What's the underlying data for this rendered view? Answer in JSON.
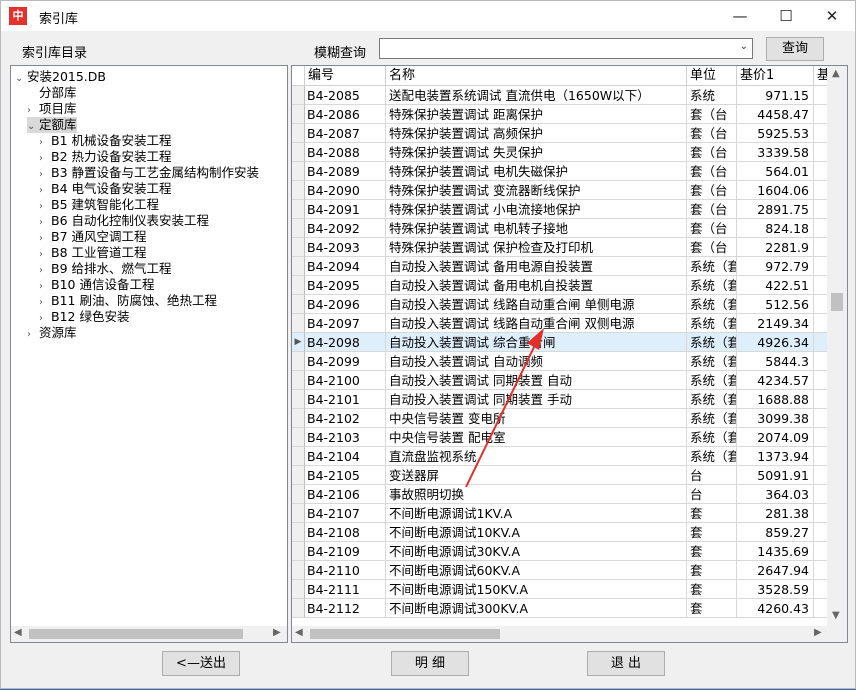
{
  "window": {
    "title": "索引库",
    "icon_text": "中"
  },
  "header": {
    "catalog_label": "索引库目录",
    "search_label": "模糊查询",
    "search_value": "",
    "search_button": "查询"
  },
  "tree": {
    "root": "安装2015.DB",
    "items": [
      {
        "label": "分部库",
        "level": 1,
        "expander": ""
      },
      {
        "label": "项目库",
        "level": 1,
        "expander": "›"
      },
      {
        "label": "定额库",
        "level": 1,
        "expander": "⌄",
        "selected": true
      },
      {
        "label": "B1 机械设备安装工程",
        "level": 2,
        "expander": "›"
      },
      {
        "label": "B2 热力设备安装工程",
        "level": 2,
        "expander": "›"
      },
      {
        "label": "B3 静置设备与工艺金属结构制作安装",
        "level": 2,
        "expander": "›"
      },
      {
        "label": "B4 电气设备安装工程",
        "level": 2,
        "expander": "›"
      },
      {
        "label": "B5 建筑智能化工程",
        "level": 2,
        "expander": "›"
      },
      {
        "label": "B6 自动化控制仪表安装工程",
        "level": 2,
        "expander": "›"
      },
      {
        "label": "B7 通风空调工程",
        "level": 2,
        "expander": "›"
      },
      {
        "label": "B8 工业管道工程",
        "level": 2,
        "expander": "›"
      },
      {
        "label": "B9 给排水、燃气工程",
        "level": 2,
        "expander": "›"
      },
      {
        "label": "B10 通信设备工程",
        "level": 2,
        "expander": "›"
      },
      {
        "label": "B11 刷油、防腐蚀、绝热工程",
        "level": 2,
        "expander": "›"
      },
      {
        "label": "B12 绿色安装",
        "level": 2,
        "expander": "›"
      },
      {
        "label": "资源库",
        "level": 1,
        "expander": "›"
      }
    ]
  },
  "table": {
    "columns": [
      "编号",
      "名称",
      "单位",
      "基价1",
      "基"
    ],
    "selected_marker": "▶",
    "rows": [
      [
        "B4-2085",
        "送配电装置系统调试 直流供电（1650W以下）",
        "系统",
        "971.15"
      ],
      [
        "B4-2086",
        "特殊保护装置调试    距离保护",
        "套（台",
        "4458.47"
      ],
      [
        "B4-2087",
        "特殊保护装置调试    高频保护",
        "套（台",
        "5925.53"
      ],
      [
        "B4-2088",
        "特殊保护装置调试    失灵保护",
        "套（台",
        "3339.58"
      ],
      [
        "B4-2089",
        "特殊保护装置调试    电机失磁保护",
        "套（台",
        "564.01"
      ],
      [
        "B4-2090",
        "特殊保护装置调试    变流器断线保护",
        "套（台",
        "1604.06"
      ],
      [
        "B4-2091",
        "特殊保护装置调试    小电流接地保护",
        "套（台",
        "2891.75"
      ],
      [
        "B4-2092",
        "特殊保护装置调试    电机转子接地",
        "套（台",
        "824.18"
      ],
      [
        "B4-2093",
        "特殊保护装置调试    保护检查及打印机",
        "套（台",
        "2281.9"
      ],
      [
        "B4-2094",
        "自动投入装置调试  备用电源自投装置",
        "系统（套",
        "972.79"
      ],
      [
        "B4-2095",
        "自动投入装置调试  备用电机自投装置",
        "系统（套",
        "422.51"
      ],
      [
        "B4-2096",
        "自动投入装置调试  线路自动重合闸  单侧电源",
        "系统（套",
        "512.56"
      ],
      [
        "B4-2097",
        "自动投入装置调试  线路自动重合闸  双侧电源",
        "系统（套",
        "2149.34"
      ],
      [
        "B4-2098",
        "自动投入装置调试  综合重合闸",
        "系统（套",
        "4926.34"
      ],
      [
        "B4-2099",
        "自动投入装置调试  自动调频",
        "系统（套",
        "5844.3"
      ],
      [
        "B4-2100",
        "自动投入装置调试  同期装置  自动",
        "系统（套",
        "4234.57"
      ],
      [
        "B4-2101",
        "自动投入装置调试  同期装置  手动",
        "系统（套",
        "1688.88"
      ],
      [
        "B4-2102",
        "中央信号装置  变电所",
        "系统（套",
        "3099.38"
      ],
      [
        "B4-2103",
        "中央信号装置  配电室",
        "系统（套",
        "2074.09"
      ],
      [
        "B4-2104",
        "直流盘监视系统",
        "系统（套",
        "1373.94"
      ],
      [
        "B4-2105",
        "变送器屏",
        "台",
        "5091.91"
      ],
      [
        "B4-2106",
        "事故照明切换",
        "台",
        "364.03"
      ],
      [
        "B4-2107",
        "不间断电源调试1KV.A",
        "套",
        "281.38"
      ],
      [
        "B4-2108",
        "不间断电源调试10KV.A",
        "套",
        "859.27"
      ],
      [
        "B4-2109",
        "不间断电源调试30KV.A",
        "套",
        "1435.69"
      ],
      [
        "B4-2110",
        "不间断电源调试60KV.A",
        "套",
        "2647.94"
      ],
      [
        "B4-2111",
        "不间断电源调试150KV.A",
        "套",
        "3528.59"
      ],
      [
        "B4-2112",
        "不间断电源调试300KV.A",
        "套",
        "4260.43"
      ]
    ],
    "selected_row_index": 13
  },
  "footer": {
    "back_button": "<—送出",
    "detail_button": "明 细",
    "exit_button": "退 出"
  },
  "colors": {
    "annotation_arrow": "#e0302a",
    "selected_row": "#dfeefb"
  }
}
